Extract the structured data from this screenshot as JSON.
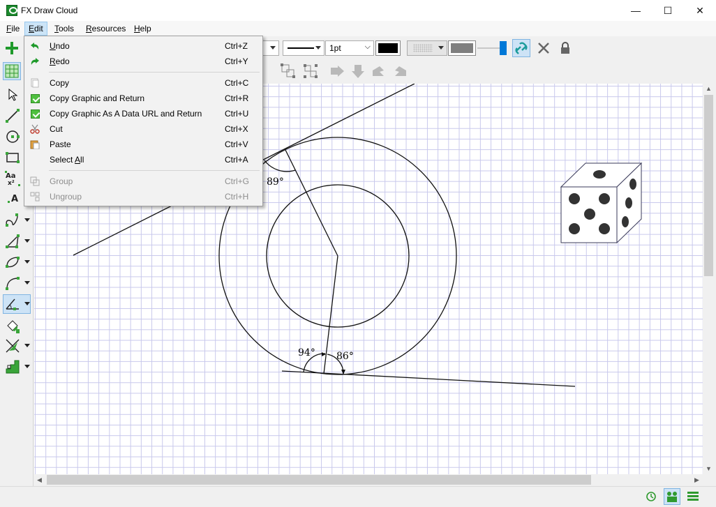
{
  "window": {
    "title": "FX Draw Cloud",
    "minimize_glyph": "—",
    "maximize_glyph": "☐",
    "close_glyph": "✕"
  },
  "menubar": [
    {
      "label": "File",
      "accel": "F",
      "rest": "ile"
    },
    {
      "label": "Edit",
      "accel": "E",
      "rest": "dit"
    },
    {
      "label": "Tools",
      "accel": "T",
      "rest": "ools"
    },
    {
      "label": "Resources",
      "accel": "R",
      "rest": "esources"
    },
    {
      "label": "Help",
      "accel": "H",
      "rest": "elp"
    }
  ],
  "toolbar": {
    "line_width": "1pt",
    "line_color": "#000000",
    "fill_color": "#7f7f7f",
    "accent": "#0078d7"
  },
  "edit_menu": {
    "items": [
      {
        "pre": "",
        "accel": "U",
        "post": "ndo",
        "shortcut": "Ctrl+Z",
        "icon": "undo-icon",
        "disabled": false
      },
      {
        "pre": "",
        "accel": "R",
        "post": "edo",
        "shortcut": "Ctrl+Y",
        "icon": "redo-icon",
        "disabled": false
      },
      {
        "pre": "Copy",
        "accel": "",
        "post": "",
        "shortcut": "Ctrl+C",
        "icon": "copy-icon",
        "disabled": false
      },
      {
        "pre": "Copy Graphic and Return",
        "accel": "",
        "post": "",
        "shortcut": "Ctrl+R",
        "icon": "check-icon",
        "disabled": false
      },
      {
        "pre": "Copy Graphic As A Data URL and Return",
        "accel": "",
        "post": "",
        "shortcut": "Ctrl+U",
        "icon": "check-icon",
        "disabled": false
      },
      {
        "pre": "Cut",
        "accel": "",
        "post": "",
        "shortcut": "Ctrl+X",
        "icon": "scissors-icon",
        "disabled": false
      },
      {
        "pre": "Paste",
        "accel": "",
        "post": "",
        "shortcut": "Ctrl+V",
        "icon": "paste-icon",
        "disabled": false
      },
      {
        "pre": "Select ",
        "accel": "A",
        "post": "ll",
        "shortcut": "Ctrl+A",
        "icon": "",
        "disabled": false
      },
      {
        "pre": "Group",
        "accel": "",
        "post": "",
        "shortcut": "Ctrl+G",
        "icon": "group-icon",
        "disabled": true
      },
      {
        "pre": "Ungroup",
        "accel": "",
        "post": "",
        "shortcut": "Ctrl+H",
        "icon": "ungroup-icon",
        "disabled": true
      }
    ]
  },
  "drawing": {
    "angle_labels": [
      "89°",
      "94°",
      "86°"
    ],
    "grid_color": "#c8c8ec",
    "die_pip_color": "#333333"
  },
  "statusbar": {
    "icons": [
      "clock-icon",
      "people-icon",
      "hamburger-icon"
    ]
  }
}
